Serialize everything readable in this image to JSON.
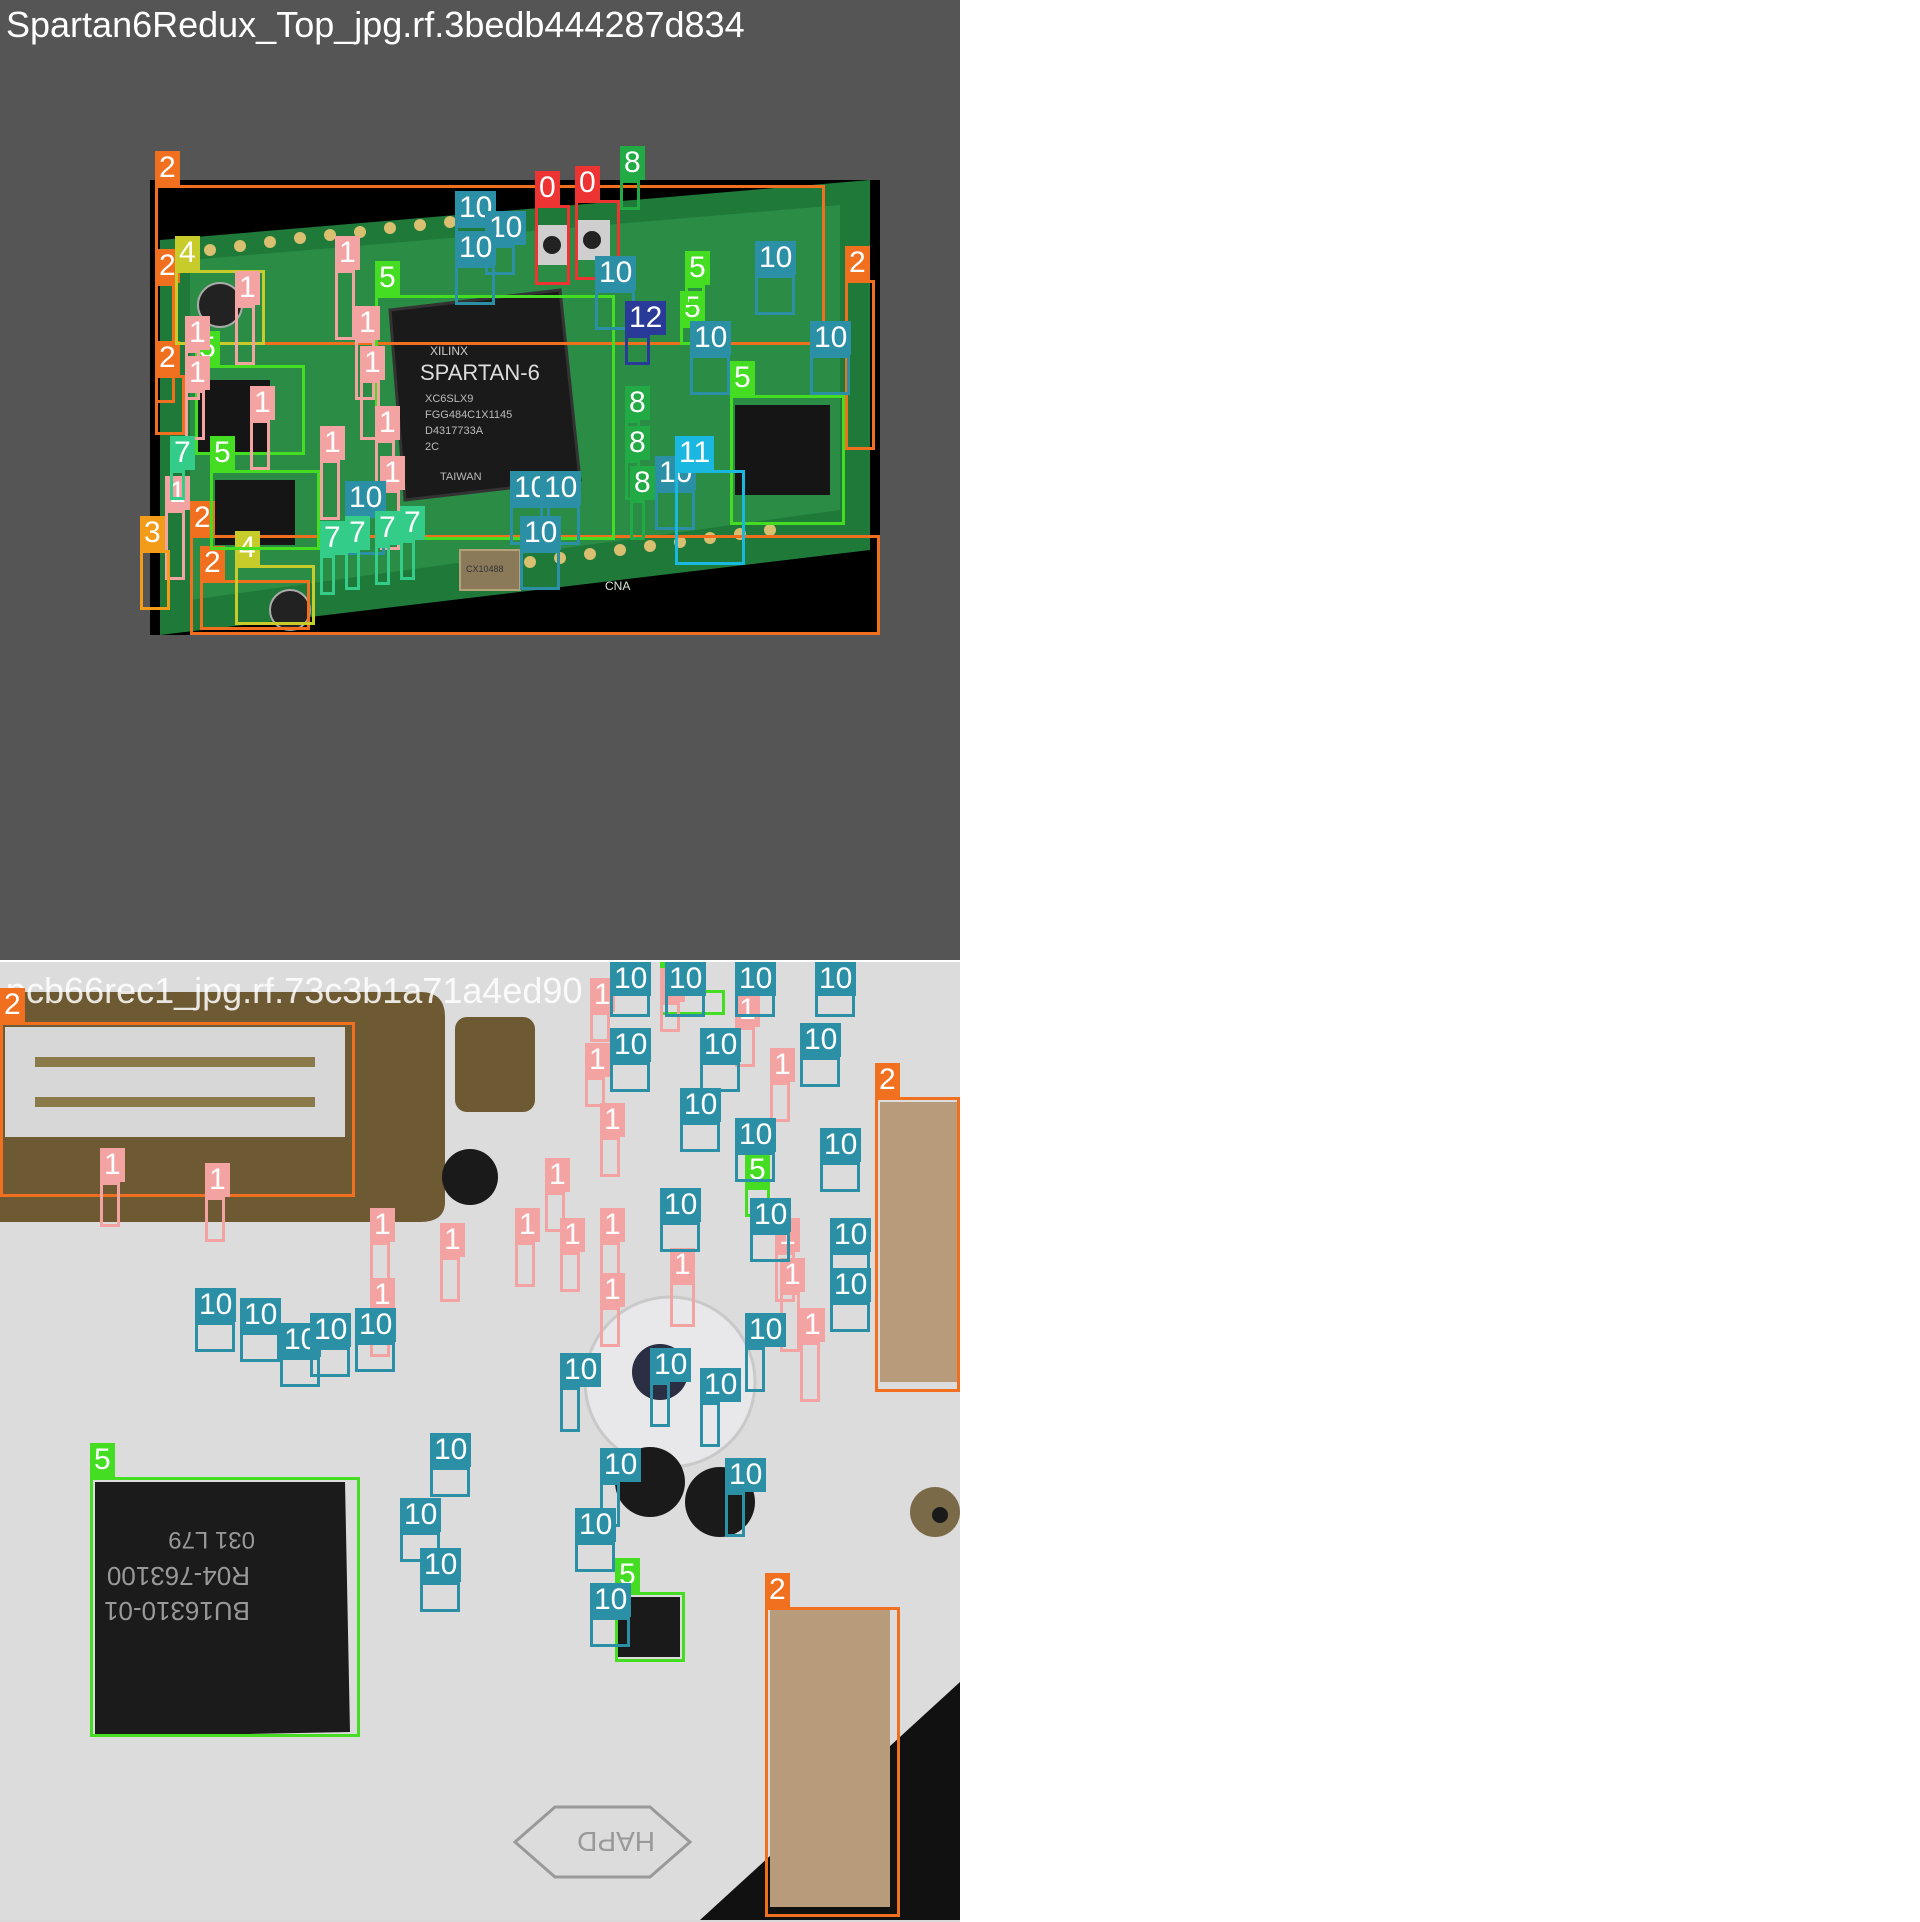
{
  "tiles": [
    {
      "title": "Spartan6Redux_Top_jpg.rf.3bedb444287d834"
    },
    {
      "title": "pcb66rec1_jpg.rf.73c3b1a71a4ed90"
    }
  ],
  "class_colors": {
    "0": "#ee3333",
    "1": "#f4a3a3",
    "2": "#f07020",
    "3": "#f39c1a",
    "4": "#c8cc2a",
    "5": "#44dd22",
    "7": "#33cc88",
    "8": "#22aa44",
    "10": "#2b8fa6",
    "11": "#1ab8e0",
    "12": "#2a3a99"
  },
  "top_detections": [
    {
      "cls": "2"
    },
    {
      "cls": "2"
    },
    {
      "cls": "2"
    },
    {
      "cls": "2"
    },
    {
      "cls": "2"
    },
    {
      "cls": "2"
    },
    {
      "cls": "0"
    },
    {
      "cls": "0"
    },
    {
      "cls": "8"
    },
    {
      "cls": "4"
    },
    {
      "cls": "4"
    },
    {
      "cls": "5"
    },
    {
      "cls": "5"
    },
    {
      "cls": "5"
    },
    {
      "cls": "5"
    },
    {
      "cls": "5"
    },
    {
      "cls": "5"
    },
    {
      "cls": "1"
    },
    {
      "cls": "1"
    },
    {
      "cls": "1"
    },
    {
      "cls": "1"
    },
    {
      "cls": "1"
    },
    {
      "cls": "1"
    },
    {
      "cls": "1"
    },
    {
      "cls": "1"
    },
    {
      "cls": "1"
    },
    {
      "cls": "1"
    },
    {
      "cls": "1"
    },
    {
      "cls": "10"
    },
    {
      "cls": "10"
    },
    {
      "cls": "10"
    },
    {
      "cls": "10"
    },
    {
      "cls": "10"
    },
    {
      "cls": "10"
    },
    {
      "cls": "10"
    },
    {
      "cls": "10"
    },
    {
      "cls": "10"
    },
    {
      "cls": "10"
    },
    {
      "cls": "10"
    },
    {
      "cls": "10"
    },
    {
      "cls": "7"
    },
    {
      "cls": "7"
    },
    {
      "cls": "7"
    },
    {
      "cls": "7"
    },
    {
      "cls": "7"
    },
    {
      "cls": "8"
    },
    {
      "cls": "8"
    },
    {
      "cls": "8"
    },
    {
      "cls": "11"
    },
    {
      "cls": "3"
    },
    {
      "cls": "12"
    }
  ],
  "bottom_detections": [
    {
      "cls": "2"
    },
    {
      "cls": "2"
    },
    {
      "cls": "2"
    },
    {
      "cls": "5"
    },
    {
      "cls": "5"
    },
    {
      "cls": "5"
    },
    {
      "cls": "5"
    },
    {
      "cls": "1"
    },
    {
      "cls": "1"
    },
    {
      "cls": "1"
    },
    {
      "cls": "1"
    },
    {
      "cls": "1"
    },
    {
      "cls": "1"
    },
    {
      "cls": "1"
    },
    {
      "cls": "1"
    },
    {
      "cls": "1"
    },
    {
      "cls": "1"
    },
    {
      "cls": "1"
    },
    {
      "cls": "1"
    },
    {
      "cls": "1"
    },
    {
      "cls": "1"
    },
    {
      "cls": "1"
    },
    {
      "cls": "1"
    },
    {
      "cls": "1"
    },
    {
      "cls": "1"
    },
    {
      "cls": "1"
    },
    {
      "cls": "1"
    },
    {
      "cls": "10"
    },
    {
      "cls": "10"
    },
    {
      "cls": "10"
    },
    {
      "cls": "10"
    },
    {
      "cls": "10"
    },
    {
      "cls": "10"
    },
    {
      "cls": "10"
    },
    {
      "cls": "10"
    },
    {
      "cls": "10"
    },
    {
      "cls": "10"
    },
    {
      "cls": "10"
    },
    {
      "cls": "10"
    },
    {
      "cls": "10"
    },
    {
      "cls": "10"
    },
    {
      "cls": "10"
    },
    {
      "cls": "10"
    },
    {
      "cls": "10"
    },
    {
      "cls": "10"
    },
    {
      "cls": "10"
    },
    {
      "cls": "10"
    },
    {
      "cls": "10"
    },
    {
      "cls": "10"
    },
    {
      "cls": "10"
    },
    {
      "cls": "10"
    },
    {
      "cls": "10"
    },
    {
      "cls": "10"
    },
    {
      "cls": "10"
    },
    {
      "cls": "10"
    },
    {
      "cls": "10"
    },
    {
      "cls": "10"
    }
  ],
  "photo_text": {
    "fpga_brand": "SPARTAN-6",
    "fpga_vendor": "XILINX",
    "fpga_part": "XC6SLX9",
    "fpga_line2": "FGG484C1X1145",
    "fpga_line3": "D4317733A",
    "fpga_line4": "2C",
    "fpga_country": "TAIWAN",
    "chip_marking_1": "BU16310-01",
    "chip_marking_2": "R04-763100",
    "chip_marking_3": "031 L79",
    "connector_label": "CNA",
    "crystal_label": "CX10488",
    "bottom_logo": "HAPD"
  }
}
